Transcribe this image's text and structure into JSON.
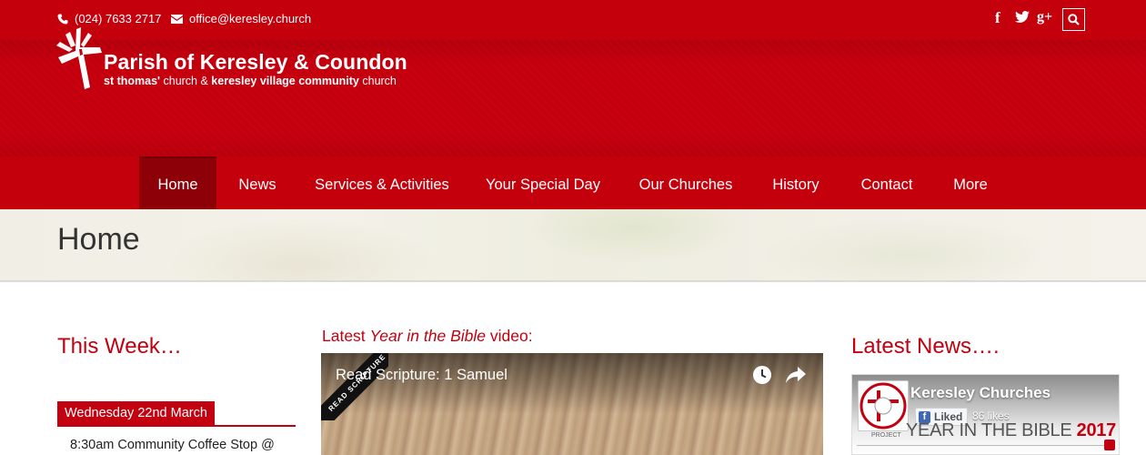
{
  "topbar": {
    "phone": "(024) 7633 2717",
    "email": "office@keresley.church",
    "social": {
      "facebook": "f",
      "twitter": "twitter-icon",
      "googleplus": "g+"
    },
    "icons": [
      "phone-icon",
      "envelope-icon",
      "facebook-icon",
      "twitter-icon",
      "google-plus-icon",
      "search-icon"
    ]
  },
  "site": {
    "title": "Parish of Keresley & Coundon",
    "subtitle_parts": [
      {
        "text": "st thomas'",
        "bold": true
      },
      {
        "text": " church & ",
        "bold": false
      },
      {
        "text": "keresley village community",
        "bold": true
      },
      {
        "text": " church",
        "bold": false
      }
    ],
    "logo_icon": "cross-logo-icon"
  },
  "nav": {
    "items": [
      {
        "label": "Home",
        "active": true
      },
      {
        "label": "News"
      },
      {
        "label": "Services & Activities"
      },
      {
        "label": "Your Special Day"
      },
      {
        "label": "Our Churches"
      },
      {
        "label": "History"
      },
      {
        "label": "Contact"
      },
      {
        "label": "More"
      }
    ]
  },
  "page": {
    "title": "Home"
  },
  "this_week": {
    "heading": "This Week…",
    "day": "Wednesday 22nd March",
    "event": "8:30am Community Coffee Stop @"
  },
  "video_section": {
    "heading_prefix": "Latest ",
    "heading_italic": "Year in the Bible",
    "heading_suffix": " video:",
    "video_title": "Read Scripture: 1 Samuel",
    "ribbon": "READ SCRIPTURE"
  },
  "news": {
    "heading": "Latest News….",
    "fb_page_name": "Keresley Churches",
    "fb_liked": "Liked",
    "fb_likes": "86 likes",
    "cover_text": "YEAR IN THE BIBLE",
    "cover_year": "2017",
    "cover_project": "PROJECT"
  },
  "colors": {
    "brand_red": "#c4000d",
    "active_nav": "#8d0008",
    "heading_red": "#c20010"
  }
}
